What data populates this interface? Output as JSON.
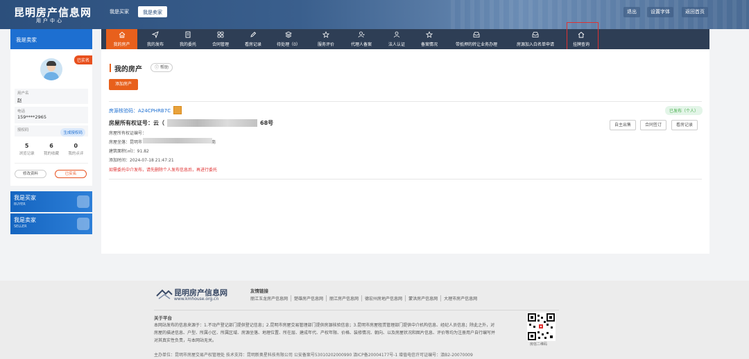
{
  "header": {
    "logo_title": "昆明房产信息网",
    "logo_sub": "用户中心",
    "buyer_label": "我是买家",
    "seller_label": "我是卖家",
    "right_buttons": [
      "退出",
      "设置字体",
      "返回首页"
    ]
  },
  "sidebar": {
    "header": "我是卖家",
    "auth_badge": "已实名",
    "fields": [
      {
        "label": "用户名",
        "value": "赵"
      },
      {
        "label": "电话",
        "value": "159****2965"
      },
      {
        "label": "授权码",
        "value": ""
      }
    ],
    "gen_code_label": "生成授权码",
    "stats": [
      {
        "value": "5",
        "label": "浏览记录"
      },
      {
        "value": "6",
        "label": "我的收藏"
      },
      {
        "value": "0",
        "label": "我的点评"
      }
    ],
    "edit_label": "修改资料",
    "sold_label": "已实名",
    "promos": [
      {
        "title": "我是买家",
        "sub": "BUYER"
      },
      {
        "title": "我是卖家",
        "sub": "SELLER"
      }
    ]
  },
  "nav": {
    "items": [
      {
        "label": "我的房产",
        "icon": "home-icon"
      },
      {
        "label": "我的发布",
        "icon": "send-icon"
      },
      {
        "label": "我的委托",
        "icon": "document-icon"
      },
      {
        "label": "合同管理",
        "icon": "grid-icon"
      },
      {
        "label": "看房记录",
        "icon": "pencil-icon"
      },
      {
        "label": "待处理（0）",
        "icon": "layers-icon"
      },
      {
        "label": "服务评价",
        "icon": "star-icon"
      },
      {
        "label": "代理人备案",
        "icon": "user-plus-icon"
      },
      {
        "label": "法人认证",
        "icon": "user-icon"
      },
      {
        "label": "备案情况",
        "icon": "star-icon"
      },
      {
        "label": "带抵押的转让业务办理",
        "icon": "inbox-icon"
      },
      {
        "label": "房源加入白名单申请",
        "icon": "inbox-icon"
      },
      {
        "label": "挂牌查询",
        "icon": "home-icon"
      }
    ]
  },
  "main": {
    "title": "我的房产",
    "help_label": "帮助",
    "add_label": "添加房产",
    "code_text": "房源核验码：A24CPHRB7C",
    "status_tag": "已发布（个人）",
    "cert_prefix": "房屋所有权证号：云（",
    "cert_suffix": "68号",
    "cert_line": "房屋所有权证编号：",
    "address_line": "房屋坐落：昆明市",
    "address_suffix": "商",
    "area_line": "建筑面积(㎡)：91.82",
    "date_line": "添加时间：2024-07-18 21:47:21",
    "warn_line": "如需委托中介发布，请先删除个人发布信息后，再进行委托",
    "actions": [
      "自主出售",
      "合同签订",
      "看房记录"
    ]
  },
  "footer": {
    "logo_title": "昆明房产信息网",
    "logo_sub": "www.kmhouse.org.cn",
    "links_title": "友情链接",
    "links": [
      "丽江玉龙房产信息网",
      "楚雄房产信息网",
      "丽江房产信息网",
      "德宏州房地产信息网",
      "蒙洪房产信息网",
      "大理市房产信息网"
    ],
    "about_title": "关于平台",
    "about_text": "本网站发布的信息来源于：1.不动产登记部门提供登记信息；2.昆明市房屋交易管理部门提供房源核验信息；3.昆明市房屋租赁管理部门提供中介机构信息、经纪人员信息；除此之外，对房屋的描述信息、户型、所属小区、所属区域、房源坐落、地理位置、所在层、建成年代、产权年限、价格、装修情况、朝向、以及房屋状况和图片信息、评价等均为注册用户自行编写并对其真实性负责，与本网站无关。",
    "qr_caption": "房信二维码",
    "bottom_line": "主办单位：昆明市房屋交易产权管理处    技术支持：昆明新奥星科技有限公司    公安备案号53010202000990    滇ICP备20004177号-1    增值电信许可证编号：滇B2-20070009"
  }
}
